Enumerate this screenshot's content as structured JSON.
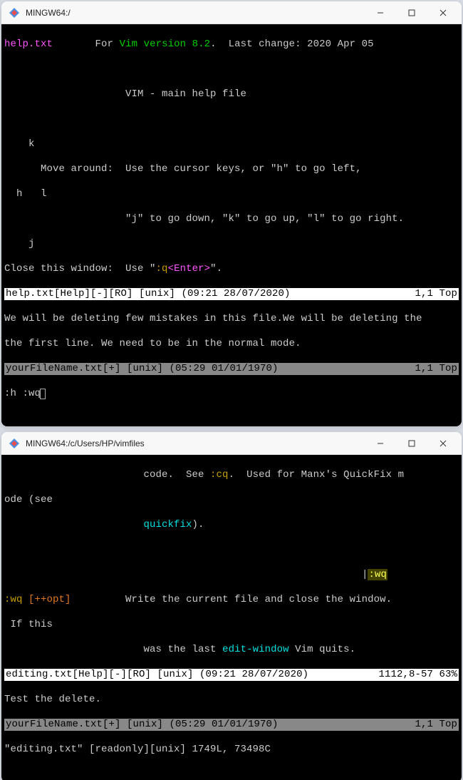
{
  "win1": {
    "title": "MINGW64:/",
    "helpfile": "help.txt",
    "for": "For",
    "vimver": "Vim version 8.2",
    "lastchange": ".  Last change: 2020 Apr 05",
    "mainhelp": "VIM - main help file",
    "k": "    k",
    "movearound": "      Move around:  Use the cursor keys, or \"h\" to go left,",
    "hl": "  h   l",
    "jkline": "                    \"j\" to go down, \"k\" to go up, \"l\" to go right.",
    "j": "    j",
    "closewin": "Close this window:  Use \"",
    "cmd_q": ":q",
    "enter": "<Enter>",
    "closewin2": "\".",
    "status1_left": "help.txt[Help][-][RO] [unix] (09:21 28/07/2020)",
    "status1_right": "1,1 Top",
    "body1": "We will be deleting few mistakes in this file.We will be deleting the",
    "body2": "the first line. We need to be in the normal mode.",
    "status2_left": "yourFileName.txt[+] [unix] (05:29 01/01/1970)",
    "status2_right": "1,1 Top",
    "cmdline": ":h :wq"
  },
  "win2": {
    "title": "MINGW64:/c/Users/HP/vimfiles",
    "line1a": "                       code.  See ",
    "cq": ":cq",
    "line1b": ".  Used for Manx's QuickFix m",
    "line1c": "ode (see",
    "quickfix": "quickfix",
    "paren": ").",
    "wq_hl": ":wq",
    "wqcmd": ":wq",
    "ppopt": "[++opt]",
    "writedesc": "         Write the current file and close the window.",
    "ifthis": " If this",
    "wasthelast": "                       was the last ",
    "editwin": "edit-window",
    "vimquits": " Vim quits.",
    "status1_left": "editing.txt[Help][-][RO] [unix] (09:21 28/07/2020)",
    "status1_right": "1112,8-57 63%",
    "body1": "Test the delete.",
    "status2_left": "yourFileName.txt[+] [unix] (05:29 01/01/1970)",
    "status2_right": "1,1 Top",
    "msgline": "\"editing.txt\" [readonly][unix] 1749L, 73498C"
  }
}
